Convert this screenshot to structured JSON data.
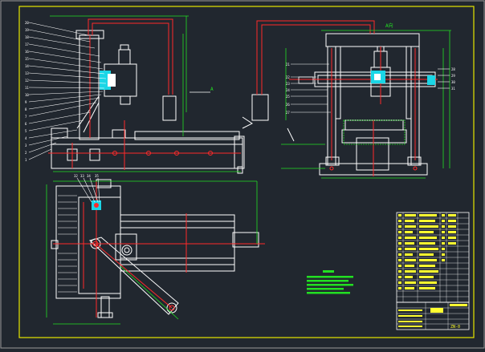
{
  "drawing": {
    "background": "#21272f",
    "frame_color": "#e6e600",
    "line_color": "#ffffff",
    "accent_red": "#ff2a2a",
    "accent_green": "#22e022",
    "accent_cyan": "#1ad6e6",
    "accent_yellow": "#ffff30"
  },
  "labels": {
    "dim_a_top": "A向",
    "section_a": "A",
    "title_block_mark": "ZN-0"
  }
}
